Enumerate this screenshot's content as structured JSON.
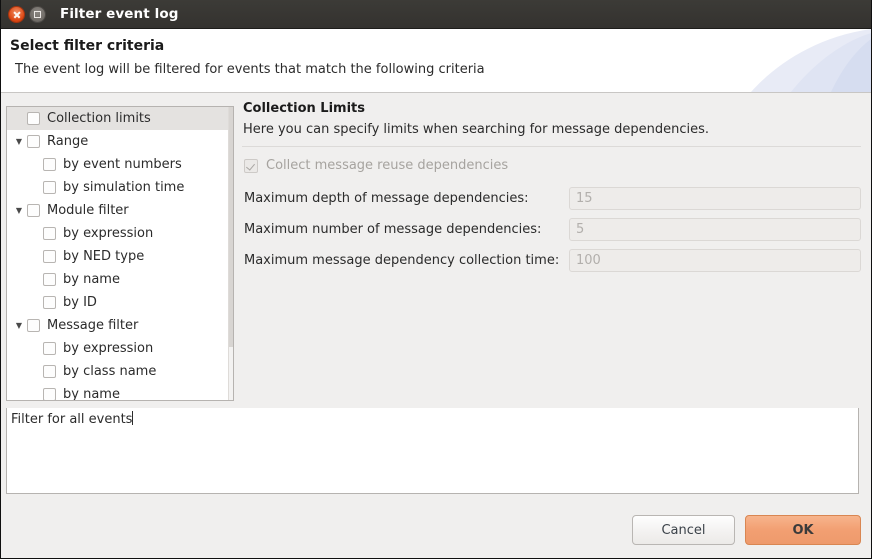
{
  "window": {
    "title": "Filter event log",
    "close_icon": "close-icon",
    "maximize_icon": "maximize-icon"
  },
  "header": {
    "title": "Select filter criteria",
    "description": "The event log will be filtered for events that match the following criteria"
  },
  "tree": {
    "items": [
      {
        "label": "Collection limits",
        "level": 0,
        "expandable": false,
        "selected": true,
        "checked": false
      },
      {
        "label": "Range",
        "level": 0,
        "expandable": true,
        "selected": false,
        "checked": false
      },
      {
        "label": "by event numbers",
        "level": 1,
        "expandable": false,
        "selected": false,
        "checked": false
      },
      {
        "label": "by simulation time",
        "level": 1,
        "expandable": false,
        "selected": false,
        "checked": false
      },
      {
        "label": "Module filter",
        "level": 0,
        "expandable": true,
        "selected": false,
        "checked": false
      },
      {
        "label": "by expression",
        "level": 1,
        "expandable": false,
        "selected": false,
        "checked": false
      },
      {
        "label": "by NED type",
        "level": 1,
        "expandable": false,
        "selected": false,
        "checked": false
      },
      {
        "label": "by name",
        "level": 1,
        "expandable": false,
        "selected": false,
        "checked": false
      },
      {
        "label": "by ID",
        "level": 1,
        "expandable": false,
        "selected": false,
        "checked": false
      },
      {
        "label": "Message filter",
        "level": 0,
        "expandable": true,
        "selected": false,
        "checked": false
      },
      {
        "label": "by expression",
        "level": 1,
        "expandable": false,
        "selected": false,
        "checked": false
      },
      {
        "label": "by class name",
        "level": 1,
        "expandable": false,
        "selected": false,
        "checked": false
      },
      {
        "label": "by name",
        "level": 1,
        "expandable": false,
        "selected": false,
        "checked": false
      }
    ],
    "expander_glyph": "▼"
  },
  "pane": {
    "title": "Collection Limits",
    "description": "Here you can specify limits when searching for message dependencies.",
    "reuse_checkbox": {
      "label": "Collect message reuse dependencies",
      "checked": true,
      "enabled": false
    },
    "fields": [
      {
        "label": "Maximum depth of message dependencies:",
        "value": "15",
        "enabled": false
      },
      {
        "label": "Maximum number of message dependencies:",
        "value": "5",
        "enabled": false
      },
      {
        "label": "Maximum message dependency collection time:",
        "value": "100",
        "enabled": false
      }
    ]
  },
  "filter_text": {
    "value": "Filter for all events"
  },
  "footer": {
    "cancel_label": "Cancel",
    "ok_label": "OK"
  },
  "colors": {
    "titlebar": "#3a3833",
    "dialog_bg": "#f0efee",
    "accent_ok": "#f29f72",
    "close_button": "#dd4814",
    "selection": "#e4e2e0"
  }
}
